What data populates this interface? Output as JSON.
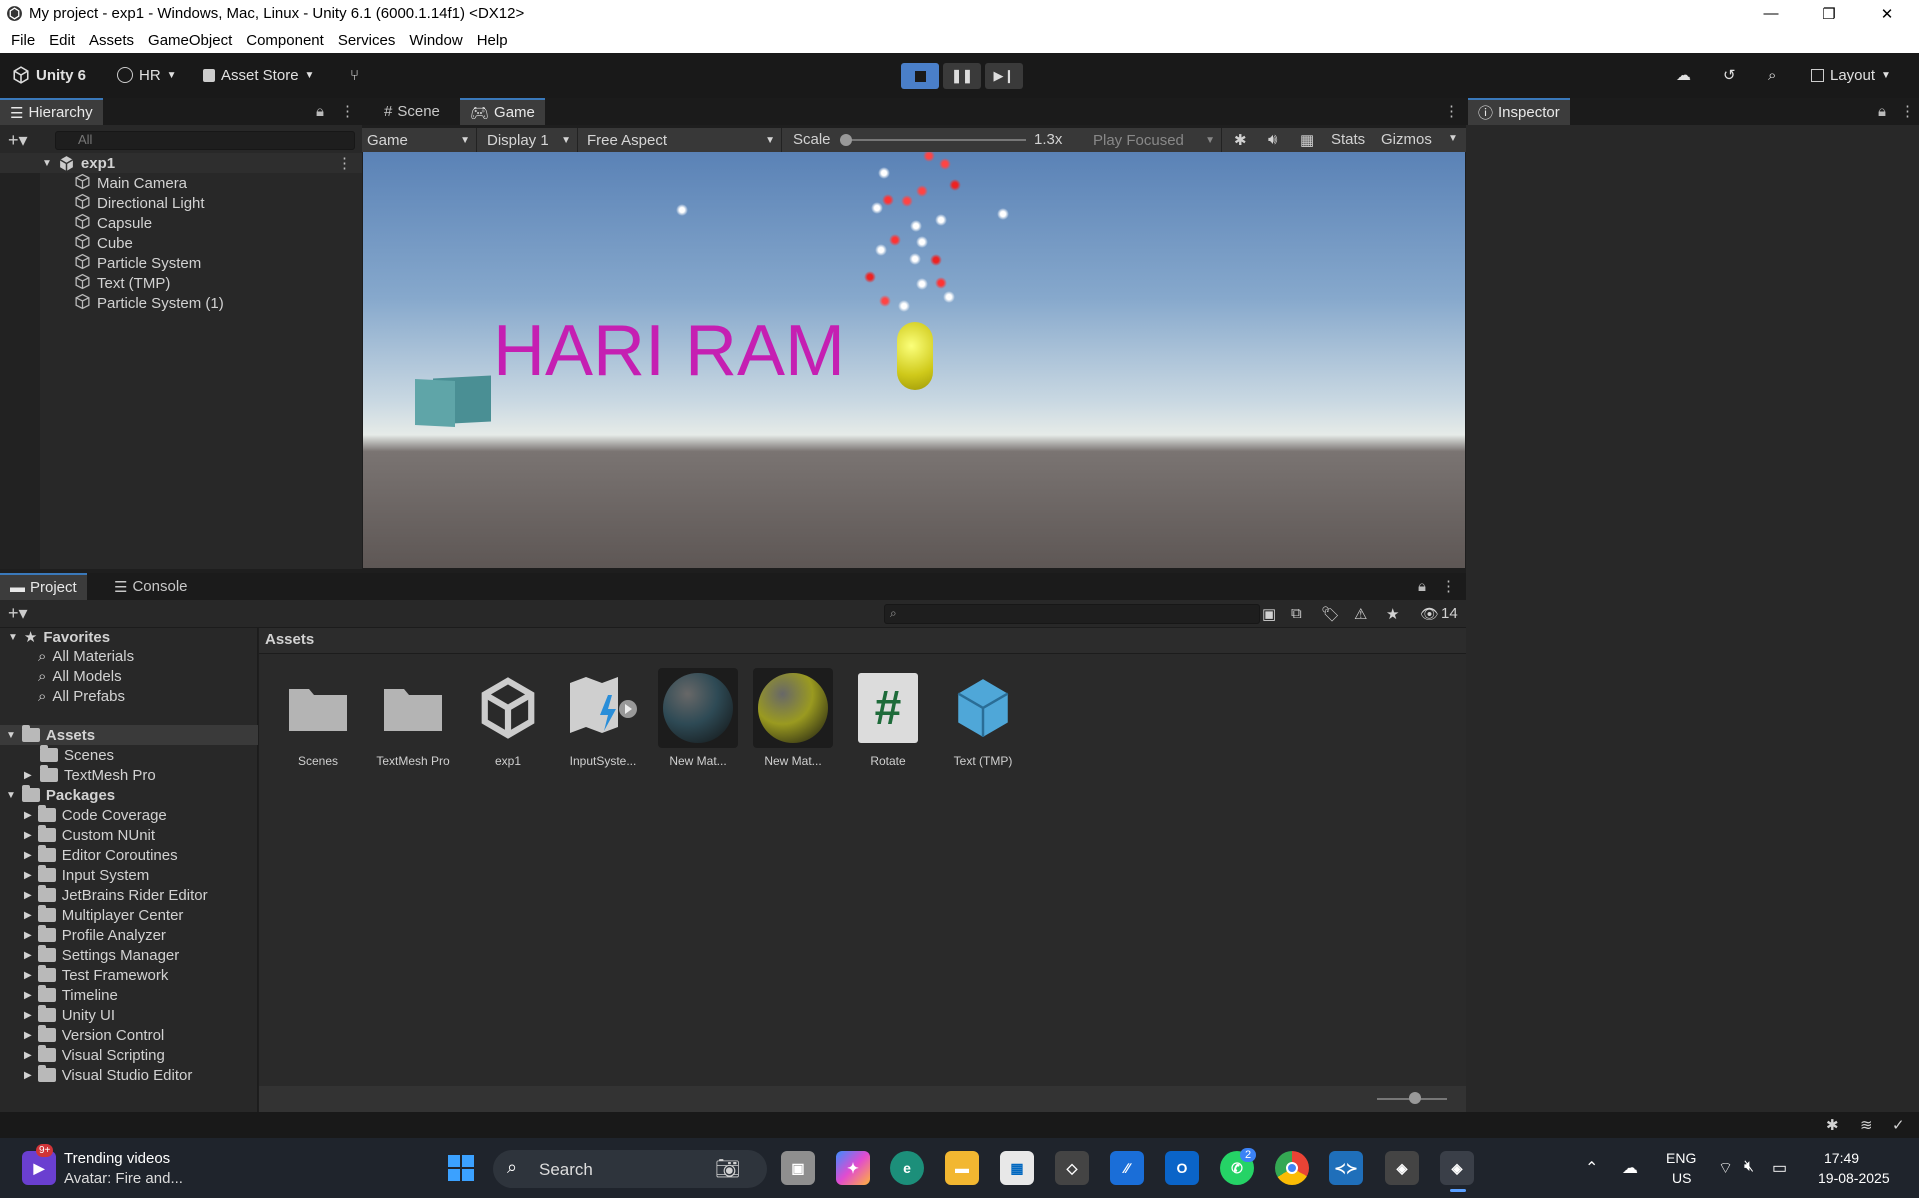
{
  "window": {
    "title": "My project - exp1 - Windows, Mac, Linux - Unity 6.1 (6000.1.14f1) <DX12>"
  },
  "menu": [
    "File",
    "Edit",
    "Assets",
    "GameObject",
    "Component",
    "Services",
    "Window",
    "Help"
  ],
  "toolbar": {
    "unity_label": "Unity 6",
    "account": "HR",
    "asset_store": "Asset Store",
    "layout": "Layout"
  },
  "hierarchy": {
    "tab": "Hierarchy",
    "search_placeholder": "All",
    "scene": "exp1",
    "items": [
      "Main Camera",
      "Directional Light",
      "Capsule",
      "Cube",
      "Particle System",
      "Text (TMP)",
      "Particle System (1)"
    ]
  },
  "center_tabs": {
    "scene": "Scene",
    "game": "Game"
  },
  "game_bar": {
    "mode": "Game",
    "display": "Display 1",
    "aspect": "Free Aspect",
    "scale_label": "Scale",
    "scale_value": "1.3x",
    "scale_fraction": 0.0,
    "play_focused": "Play Focused",
    "stats": "Stats",
    "gizmos": "Gizmos"
  },
  "game_view": {
    "text": "HARI RAM",
    "text_color": "#c51fb2"
  },
  "inspector": {
    "tab": "Inspector"
  },
  "bottom_tabs": {
    "project": "Project",
    "console": "Console"
  },
  "project": {
    "hidden_count": "14",
    "favorites_label": "Favorites",
    "favorites": [
      "All Materials",
      "All Models",
      "All Prefabs"
    ],
    "assets_label": "Assets",
    "assets_folders": [
      {
        "name": "Scenes",
        "expandable": false
      },
      {
        "name": "TextMesh Pro",
        "expandable": true
      }
    ],
    "packages_label": "Packages",
    "packages": [
      "Code Coverage",
      "Custom NUnit",
      "Editor Coroutines",
      "Input System",
      "JetBrains Rider Editor",
      "Multiplayer Center",
      "Profile Analyzer",
      "Settings Manager",
      "Test Framework",
      "Timeline",
      "Unity UI",
      "Version Control",
      "Visual Scripting",
      "Visual Studio Editor"
    ],
    "breadcrumb": "Assets",
    "grid": [
      {
        "name": "Scenes",
        "icon": "folder-icon"
      },
      {
        "name": "TextMesh Pro",
        "icon": "folder-icon"
      },
      {
        "name": "exp1",
        "icon": "unity-scene-icon"
      },
      {
        "name": "InputSyste...",
        "icon": "input-actions-icon"
      },
      {
        "name": "New Mat...",
        "icon": "material-dark-teal-icon",
        "color": "#2e4a55"
      },
      {
        "name": "New Mat...",
        "icon": "material-yellow-icon",
        "color": "#9a9a20"
      },
      {
        "name": "Rotate",
        "icon": "csharp-script-icon"
      },
      {
        "name": "Text (TMP)",
        "icon": "prefab-cube-icon",
        "color": "#4fa7d8"
      }
    ]
  },
  "taskbar": {
    "news_title": "Trending videos",
    "news_sub": "Avatar: Fire and...",
    "news_badge": "9+",
    "search": "Search",
    "whatsapp_badge": "2",
    "lang1": "ENG",
    "lang2": "US",
    "time": "17:49",
    "date": "19-08-2025"
  }
}
